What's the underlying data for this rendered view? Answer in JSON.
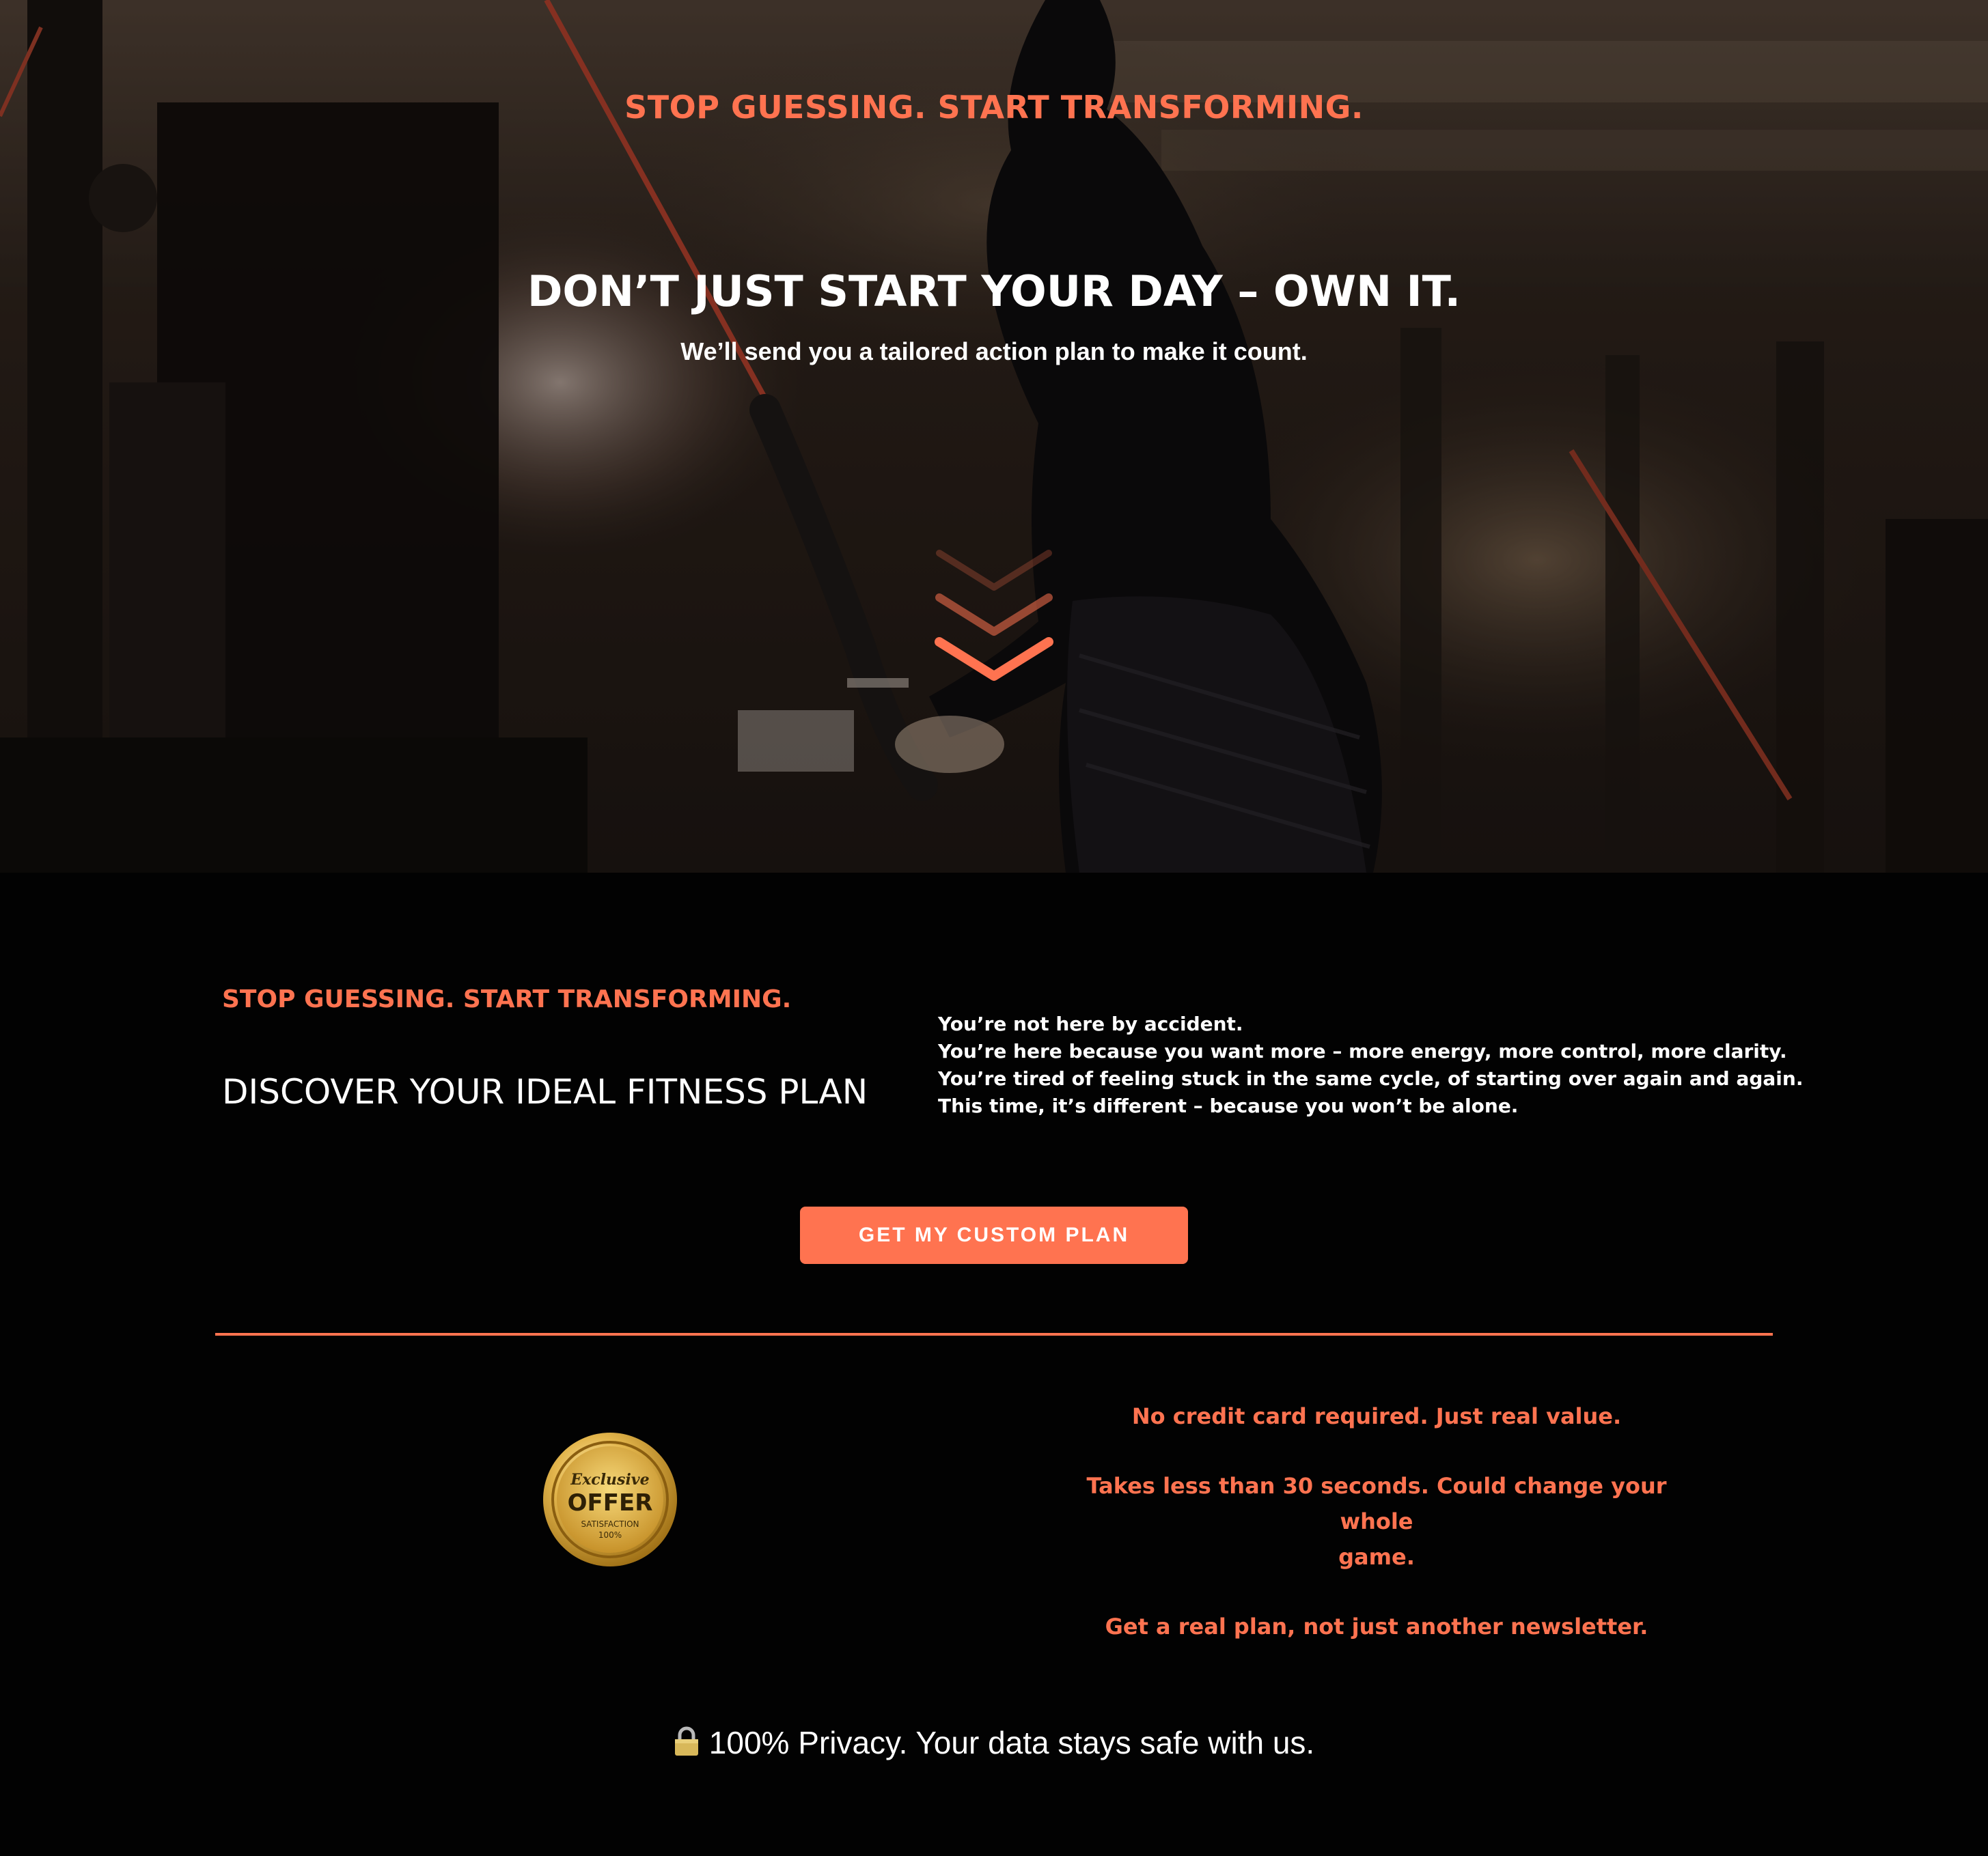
{
  "hero": {
    "kicker": "STOP GUESSING. START TRANSFORMING.",
    "title": "DON’T JUST START YOUR DAY – OWN IT.",
    "subtitle": "We’ll send you a tailored action plan to make it count.",
    "background": "gym-workout-photo",
    "scroll_icon": "chevron-down-icon"
  },
  "intro": {
    "kicker": "STOP GUESSING. START TRANSFORMING.",
    "heading": "DISCOVER YOUR IDEAL FITNESS PLAN",
    "body": [
      "You’re not here by accident.",
      "You’re here because you want more – more energy, more control, more clarity.",
      "You’re tired of feeling stuck in the same cycle, of starting over again and again.",
      "This time, it’s different – because you won’t be alone."
    ]
  },
  "cta": {
    "label": "GET MY CUSTOM PLAN"
  },
  "offer": {
    "badge": {
      "top": "Exclusive",
      "main": "OFFER",
      "sub": "SATISFACTION",
      "percent": "100%"
    },
    "line1": "No credit card required. Just real value.",
    "line2a": "Takes less than 30 seconds. Could change your whole",
    "line2b": "game.",
    "line3": "Get a real plan, not just another newsletter."
  },
  "privacy": {
    "icon": "lock-icon",
    "text": "100% Privacy. Your data stays safe with us."
  },
  "colors": {
    "accent": "#ff7350",
    "background": "#020202",
    "text": "#ffffff"
  }
}
